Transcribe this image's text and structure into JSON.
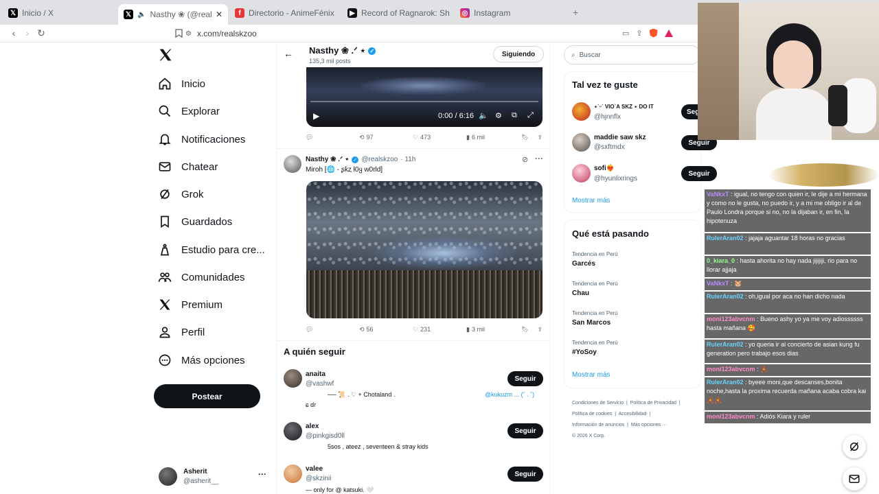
{
  "browser": {
    "tabs": [
      {
        "label": "Inicio / X",
        "icon": "x-logo-icon"
      },
      {
        "label": "Nasthy ❀ (@realskzoo) / X",
        "icon": "x-logo-icon"
      },
      {
        "label": "Directorio - AnimeFénix",
        "icon": "animefenix-icon"
      },
      {
        "label": "Record of Ragnarok: Shuumatsu no",
        "icon": "youtube-icon"
      },
      {
        "label": "Instagram",
        "icon": "instagram-icon"
      }
    ],
    "new_tab": "+",
    "url": "x.com/realskzoo"
  },
  "nav": {
    "items": [
      {
        "label": "Inicio",
        "icon": "home-icon"
      },
      {
        "label": "Explorar",
        "icon": "search-icon"
      },
      {
        "label": "Notificaciones",
        "icon": "bell-icon"
      },
      {
        "label": "Chatear",
        "icon": "mail-icon"
      },
      {
        "label": "Grok",
        "icon": "grok-icon"
      },
      {
        "label": "Guardados",
        "icon": "bookmark-icon"
      },
      {
        "label": "Estudio para cre...",
        "icon": "studio-icon"
      },
      {
        "label": "Comunidades",
        "icon": "communities-icon"
      },
      {
        "label": "Premium",
        "icon": "x-premium-icon"
      },
      {
        "label": "Perfil",
        "icon": "profile-icon"
      },
      {
        "label": "Más opciones",
        "icon": "more-circle-icon"
      }
    ],
    "post_button": "Postear",
    "account": {
      "name": "Asherit",
      "handle": "@asherit__"
    }
  },
  "profile_header": {
    "name": "Nasthy ❀ .ᐟ ⋆",
    "posts": "135,3 mil posts",
    "follow_state": "Siguiendo"
  },
  "video": {
    "time": "0:00 / 6:16"
  },
  "post1_actions": {
    "retweets": "97",
    "likes": "473",
    "views": "6 mil"
  },
  "post2": {
    "name": "Nasthy ❀ .ᐟ ⋆",
    "handle": "@realskzoo",
    "time": "· 11h",
    "text": "Miroh [🌐 - ʂƙȥ ƚ0ყ w0rld]",
    "retweets": "56",
    "likes": "231",
    "views": "3 mil"
  },
  "who_to_follow": {
    "title": "A quién seguir",
    "button": "Seguir",
    "users": [
      {
        "name": "anaita",
        "handle": "@vashwf",
        "bio": "── 📜 . ♡ + Chotaland .",
        "bio2": "@kukuzm ... (˘ . ˘)",
        "bio3": "ɕ ɗɾ"
      },
      {
        "name": "alex",
        "handle": "@pinkgisd0ll",
        "bio": "5sos , ateez , seventeen & stray kids"
      },
      {
        "name": "valee",
        "handle": "@skzinii",
        "bio": "— only for @ katsuki. 🤍"
      }
    ]
  },
  "search": {
    "placeholder": "Buscar"
  },
  "suggest": {
    "title": "Tal vez te guste",
    "button": "Seguir",
    "users": [
      {
        "name": "⋆˙ᵕ˙ VIO`A SKZ ⋆ DO IT",
        "handle": "@hjnnflx"
      },
      {
        "name": "maddie saw skz",
        "handle": "@sxftmdx"
      },
      {
        "name": "sofi❤️‍🔥",
        "handle": "@hyunlixrings"
      }
    ],
    "more": "Mostrar más"
  },
  "trends": {
    "title": "Qué está pasando",
    "items": [
      {
        "context": "Tendencia en Perú",
        "topic": "Garcés"
      },
      {
        "context": "Tendencia en Perú",
        "topic": "Chau"
      },
      {
        "context": "Tendencia en Perú",
        "topic": "San Marcos"
      },
      {
        "context": "Tendencia en Perú",
        "topic": "#YoSoy"
      }
    ],
    "more": "Mostrar más"
  },
  "footer": {
    "links": [
      "Condiciones de Servicio",
      "Política de Privacidad",
      "Política de cookies",
      "Accesibilidad",
      "Información de anuncios",
      "Más opciones ···"
    ],
    "copyright": "© 2026 X Corp."
  },
  "chat": {
    "messages": [
      {
        "user": "VaNkxT",
        "text": ": igual, no tengo con quien ir, le dije a mi hermana y como no le gusta, no puedo ir, y a mi me obligo ir al de Paulo Londra porque si no, no la dijaban ir, en fin, la hipotenuza"
      },
      {
        "user": "RulerAran02",
        "text": ": jajaja aguantar 18 horas no gracias"
      },
      {
        "user": "0_kiara_0",
        "text": ": hasta ahorita no hay nada jijijiji, rio para no llorar ajjaja"
      },
      {
        "user": "VaNkxT",
        "text": ": 🐹"
      },
      {
        "user": "RulerAran02",
        "text": ": oh,igual por aca no han dicho nada"
      },
      {
        "user": "moni123abvcnm",
        "text": ": Bueno ashy yo ya me voy adiossssss hasta mañana 🥰"
      },
      {
        "user": "RulerAran02",
        "text": ": yo queria ir al concierto de asian kung fu generation pero trabajo esos dias"
      },
      {
        "user": "moni123abvcnm",
        "text": ": 🧸"
      },
      {
        "user": "RulerAran02",
        "text": ": byeee moni,que descanses,bonita noche,hasta la proxima recuerda mañana acaba cobra kai 🧸🧸"
      },
      {
        "user": "moni123abvcnm",
        "text": ": Adiós Kiara y ruler"
      }
    ]
  }
}
